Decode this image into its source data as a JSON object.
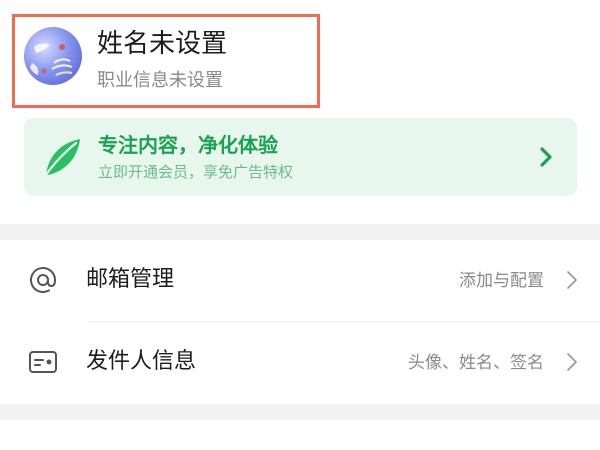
{
  "profile": {
    "name": "姓名未设置",
    "subtitle": "职业信息未设置",
    "highlight_color": "#f26b4f"
  },
  "promo": {
    "title": "专注内容，净化体验",
    "subtitle": "立即开通会员，享免广告特权",
    "icon": "leaf-icon",
    "accent_color": "#1aa251",
    "background_color": "#e7f7ed"
  },
  "settings": {
    "items": [
      {
        "label": "邮箱管理",
        "value": "添加与配置",
        "icon": "at-icon"
      },
      {
        "label": "发件人信息",
        "value": "头像、姓名、签名",
        "icon": "id-card-icon"
      }
    ]
  }
}
